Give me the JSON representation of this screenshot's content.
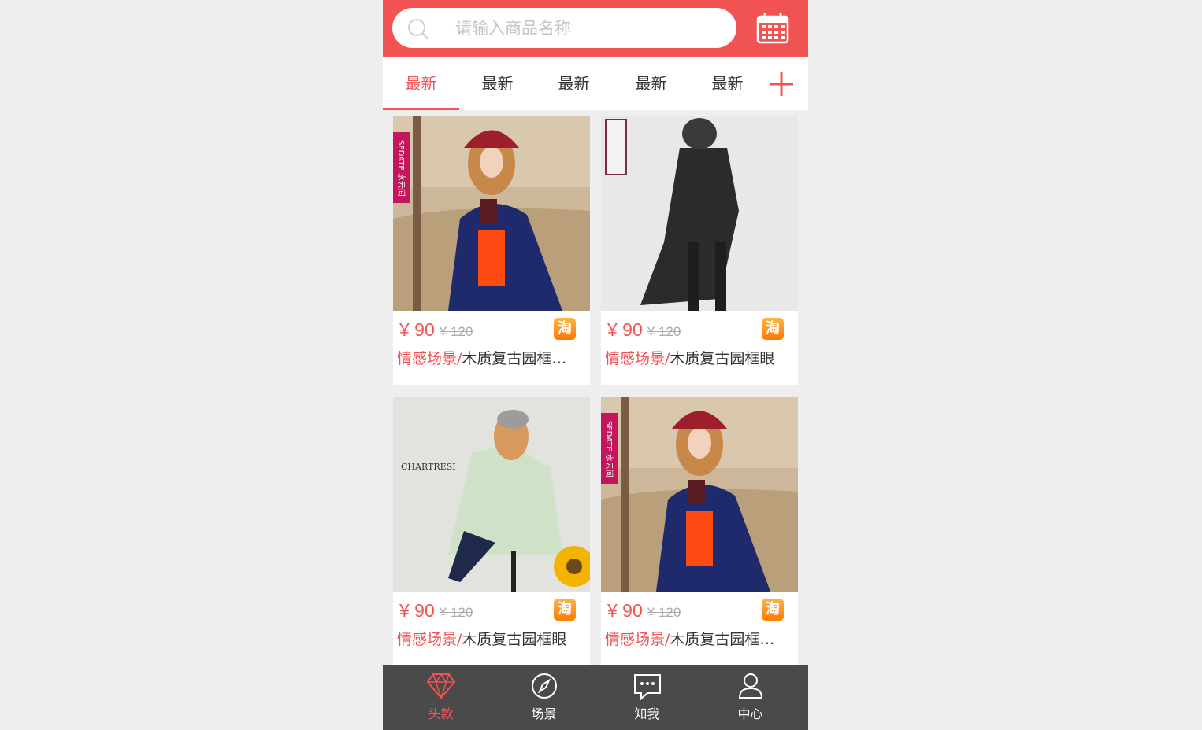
{
  "colors": {
    "accent": "#f15353",
    "nav_bg": "#4a4a4a",
    "tao_orange": "#ff8c00"
  },
  "search": {
    "placeholder": "请输入商品名称",
    "icon": "search-icon"
  },
  "header": {
    "calendar_icon": "calendar-icon"
  },
  "tabs": [
    {
      "label": "最新",
      "active": true
    },
    {
      "label": "最新",
      "active": false
    },
    {
      "label": "最新",
      "active": false
    },
    {
      "label": "最新",
      "active": false
    },
    {
      "label": "最新",
      "active": false
    }
  ],
  "add_tab_icon": "plus-icon",
  "products": [
    {
      "price": "¥ 90",
      "old_price": "¥ 120",
      "tag": "情感场景/",
      "name": "木质复古园框…",
      "badge": "淘",
      "image": "model-navy-coat-red-hat",
      "brand_mark": "SEDATE 水云间"
    },
    {
      "price": "¥ 90",
      "old_price": "¥ 120",
      "tag": "情感场景/",
      "name": "木质复古园框眼",
      "badge": "淘",
      "image": "model-black-cape-coat",
      "brand_mark": ""
    },
    {
      "price": "¥ 90",
      "old_price": "¥ 120",
      "tag": "情感场景/",
      "name": "木质复古园框眼",
      "badge": "淘",
      "image": "model-plaid-coat-sunflower",
      "brand_mark": "CHARTRESI"
    },
    {
      "price": "¥ 90",
      "old_price": "¥ 120",
      "tag": "情感场景/",
      "name": "木质复古园框…",
      "badge": "淘",
      "image": "model-navy-coat-red-hat",
      "brand_mark": "SEDATE 水云间"
    }
  ],
  "bottom_nav": [
    {
      "label": "头款",
      "icon": "diamond-icon",
      "active": true
    },
    {
      "label": "场景",
      "icon": "compass-icon",
      "active": false
    },
    {
      "label": "知我",
      "icon": "chat-bubble-icon",
      "active": false
    },
    {
      "label": "中心",
      "icon": "user-icon",
      "active": false
    }
  ]
}
